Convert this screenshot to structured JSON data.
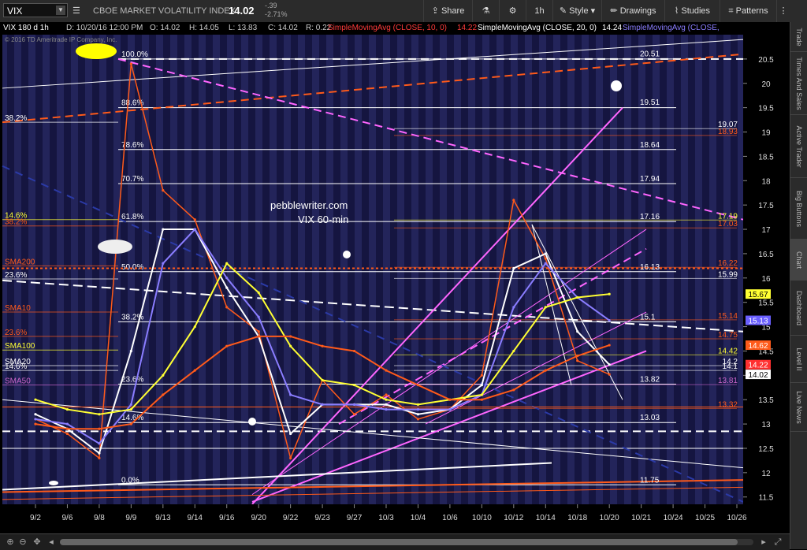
{
  "toolbar": {
    "symbol": "VIX",
    "name": "CBOE MARKET VOLATILITY INDEX",
    "last": "14.02",
    "change": "-.39",
    "change_pct": "-2.71%",
    "buttons": {
      "share": "Share",
      "interval": "1h",
      "style": "Style",
      "drawings": "Drawings",
      "studies": "Studies",
      "patterns": "Patterns"
    }
  },
  "header": {
    "study_line": "VIX 180 d 1h",
    "date": "D: 10/20/16 12:00 PM",
    "open": "O: 14.02",
    "high": "H: 14.05",
    "low": "L: 13.83",
    "close": "C: 14.02",
    "range": "R: 0.22",
    "sma10_label": "SimpleMovingAvg (CLOSE, 10, 0)",
    "sma10_value": "14.22",
    "sma20_label": "SimpleMovingAvg (CLOSE, 20, 0)",
    "sma20_value": "14.24",
    "sma_next_label": "SimpleMovingAvg (CLOSE,",
    "copyright": "© 2016 TD Ameritrade IP Company, Inc."
  },
  "sidebar": {
    "tabs": [
      "Trade",
      "Times And Sales",
      "Active Trader",
      "Big Buttons",
      "Chart",
      "Dashboard",
      "Level II",
      "Live News"
    ],
    "active": "Chart"
  },
  "watermark": {
    "line1": "pebblewriter.com",
    "line2": "VIX 60-min"
  },
  "chart_data": {
    "type": "line",
    "x": [
      "9/2",
      "9/6",
      "9/8",
      "9/9",
      "9/13",
      "9/14",
      "9/16",
      "9/20",
      "9/22",
      "9/23",
      "9/27",
      "10/3",
      "10/4",
      "10/6",
      "10/10",
      "10/12",
      "10/14",
      "10/18",
      "10/20",
      "10/21",
      "10/24",
      "10/25",
      "10/26"
    ],
    "ylim": [
      11.35,
      21.0
    ],
    "y_ticks": [
      11.5,
      12,
      12.5,
      13,
      13.5,
      14,
      14.5,
      15,
      15.5,
      16,
      16.5,
      17,
      17.5,
      18,
      18.5,
      19,
      19.5,
      20,
      20.5
    ],
    "series": [
      {
        "name": "VIX",
        "color": "#ff5a1a",
        "values": [
          13.1,
          12.8,
          12.3,
          20.4,
          17.8,
          17.2,
          15.4,
          14.9,
          12.3,
          13.9,
          13.2,
          13.6,
          13.1,
          13.3,
          14.0,
          17.6,
          16.4,
          14.3,
          14.02
        ]
      },
      {
        "name": "SimpleMovingAvg (CLOSE, 10, 0)",
        "color": "#ffffff",
        "values": [
          13.2,
          12.9,
          12.4,
          14.5,
          17.0,
          17.0,
          15.8,
          14.8,
          12.8,
          13.4,
          13.4,
          13.4,
          13.2,
          13.3,
          13.8,
          16.2,
          16.5,
          14.9,
          14.22
        ]
      },
      {
        "name": "SimpleMovingAvg (CLOSE, 20, 0)",
        "color": "#8a7dff",
        "values": [
          13.1,
          13.0,
          12.6,
          13.4,
          16.3,
          17.0,
          16.0,
          15.2,
          13.6,
          13.4,
          13.4,
          13.3,
          13.3,
          13.3,
          13.6,
          15.4,
          16.3,
          15.6,
          15.13
        ]
      },
      {
        "name": "SMA50",
        "color": "#ffff33",
        "values": [
          13.5,
          13.3,
          13.2,
          13.3,
          14.0,
          15.0,
          16.3,
          15.7,
          14.6,
          13.9,
          13.8,
          13.5,
          13.4,
          13.5,
          13.6,
          14.5,
          15.4,
          15.6,
          15.67
        ]
      },
      {
        "name": "SMA100",
        "color": "#ff5a1a",
        "values": [
          13.0,
          12.9,
          12.9,
          13.0,
          13.6,
          14.1,
          14.6,
          14.8,
          14.8,
          14.6,
          14.5,
          14.1,
          13.8,
          13.5,
          13.5,
          13.7,
          14.1,
          14.4,
          14.62
        ]
      }
    ],
    "fib_left": [
      {
        "label": "100.0%",
        "value": 20.5
      },
      {
        "label": "88.6%",
        "value": 19.5
      },
      {
        "label": "78.6%",
        "value": 18.64
      },
      {
        "label": "70.7%",
        "value": 17.94
      },
      {
        "label": "61.8%",
        "value": 17.16
      },
      {
        "label": "50.0%",
        "value": 16.13
      },
      {
        "label": "38.2%",
        "value": 15.1
      },
      {
        "label": "23.6%",
        "value": 13.82
      },
      {
        "label": "14.6%",
        "value": 13.03
      },
      {
        "label": "0.0%",
        "value": 11.75
      }
    ],
    "level_labels": [
      {
        "text": "20.51",
        "value": 20.51,
        "color": "#ffffff"
      },
      {
        "text": "19.51",
        "value": 19.51,
        "color": "#ffffff"
      },
      {
        "text": "18.64",
        "value": 18.64,
        "color": "#ffffff"
      },
      {
        "text": "17.94",
        "value": 17.94,
        "color": "#ffffff"
      },
      {
        "text": "17.16",
        "value": 17.16,
        "color": "#ffffff"
      },
      {
        "text": "16.13",
        "value": 16.13,
        "color": "#ffffff"
      },
      {
        "text": "15.1",
        "value": 15.1,
        "color": "#ffffff"
      },
      {
        "text": "13.82",
        "value": 13.82,
        "color": "#ffffff"
      },
      {
        "text": "13.03",
        "value": 13.03,
        "color": "#ffffff"
      },
      {
        "text": "11.75",
        "value": 11.75,
        "color": "#ffffff"
      }
    ],
    "right_labels": [
      {
        "text": "19.07",
        "value": 19.07,
        "color": "#ffffff"
      },
      {
        "text": "18.93",
        "value": 18.93,
        "color": "#ff5a1a"
      },
      {
        "text": "17.19",
        "value": 17.19,
        "color": "#ffff33"
      },
      {
        "text": "17.03",
        "value": 17.03,
        "color": "#ff5a1a"
      },
      {
        "text": "16.22",
        "value": 16.22,
        "color": "#ff5a1a"
      },
      {
        "text": "15.99",
        "value": 15.99,
        "color": "#ffffff"
      },
      {
        "text": "15.14",
        "value": 15.14,
        "color": "#ff5a1a"
      },
      {
        "text": "14.75",
        "value": 14.75,
        "color": "#ff5a1a"
      },
      {
        "text": "14.42",
        "value": 14.42,
        "color": "#ffff33"
      },
      {
        "text": "14.2",
        "value": 14.2,
        "color": "#ffffff"
      },
      {
        "text": "14.1",
        "value": 14.1,
        "color": "#ffffff"
      },
      {
        "text": "13.81",
        "value": 13.81,
        "color": "#cc66cc"
      },
      {
        "text": "13.32",
        "value": 13.32,
        "color": "#ff5a1a"
      }
    ],
    "left_labels": [
      {
        "text": "38.2%",
        "value": 19.2,
        "color": "#ffffff"
      },
      {
        "text": "14.6%",
        "value": 17.2,
        "color": "#ffff33"
      },
      {
        "text": "38.2%",
        "value": 17.07,
        "color": "#ff5a1a"
      },
      {
        "text": "SMA200",
        "value": 16.25,
        "color": "#ff5a1a"
      },
      {
        "text": "23.6%",
        "value": 15.98,
        "color": "#ffffff"
      },
      {
        "text": "SMA10",
        "value": 15.3,
        "color": "#ff5a1a"
      },
      {
        "text": "23.6%",
        "value": 14.8,
        "color": "#ff5a1a"
      },
      {
        "text": "SMA100",
        "value": 14.52,
        "color": "#ffff33"
      },
      {
        "text": "SMA20",
        "value": 14.2,
        "color": "#ffffff"
      },
      {
        "text": "14.6%",
        "value": 14.1,
        "color": "#ffffff"
      },
      {
        "text": "SMA50",
        "value": 13.8,
        "color": "#cc66cc"
      }
    ],
    "price_badges": [
      {
        "text": "15.67",
        "value": 15.67,
        "bg": "#ffff33",
        "fg": "#000000"
      },
      {
        "text": "15.13",
        "value": 15.13,
        "bg": "#6a5fff",
        "fg": "#ffffff"
      },
      {
        "text": "14.62",
        "value": 14.62,
        "bg": "#ff5a1a",
        "fg": "#ffffff"
      },
      {
        "text": "14.22",
        "value": 14.22,
        "bg": "#ff3030",
        "fg": "#ffffff"
      },
      {
        "text": "14.02",
        "value": 14.02,
        "bg": "#ffffff",
        "fg": "#000000"
      }
    ]
  }
}
